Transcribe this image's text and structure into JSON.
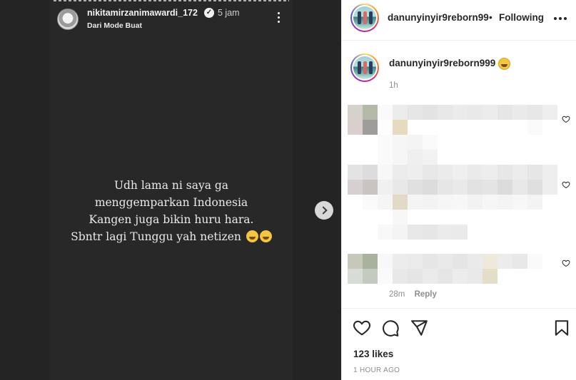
{
  "story": {
    "username": "nikitamirzanimawardi_172",
    "verified_icon": "verified-badge-icon",
    "time": "5 jam",
    "subtitle": "Dari Mode Buat",
    "lines": [
      "Udh lama ni saya ga",
      "menggemparkan Indonesia",
      "Kangen juga bikin huru hara.",
      "Sbntr lagi Tunggu yah netizen"
    ],
    "trailing_emoji": "rolling-on-floor-laughing-emoji"
  },
  "post": {
    "header": {
      "username": "danunyinyir9reborn99",
      "separator": "•",
      "follow_label": "Following"
    },
    "caption": {
      "username": "danunyinyir9reborn999",
      "time": "1h"
    },
    "comments_meta": {
      "time": "28m",
      "reply_label": "Reply"
    },
    "likes": "123 likes",
    "post_time": "1 HOUR AGO"
  },
  "colors": {
    "media_bg": "#242424",
    "story_bg": "#282828",
    "text_primary": "#262626",
    "text_secondary": "#8e8e8e"
  }
}
